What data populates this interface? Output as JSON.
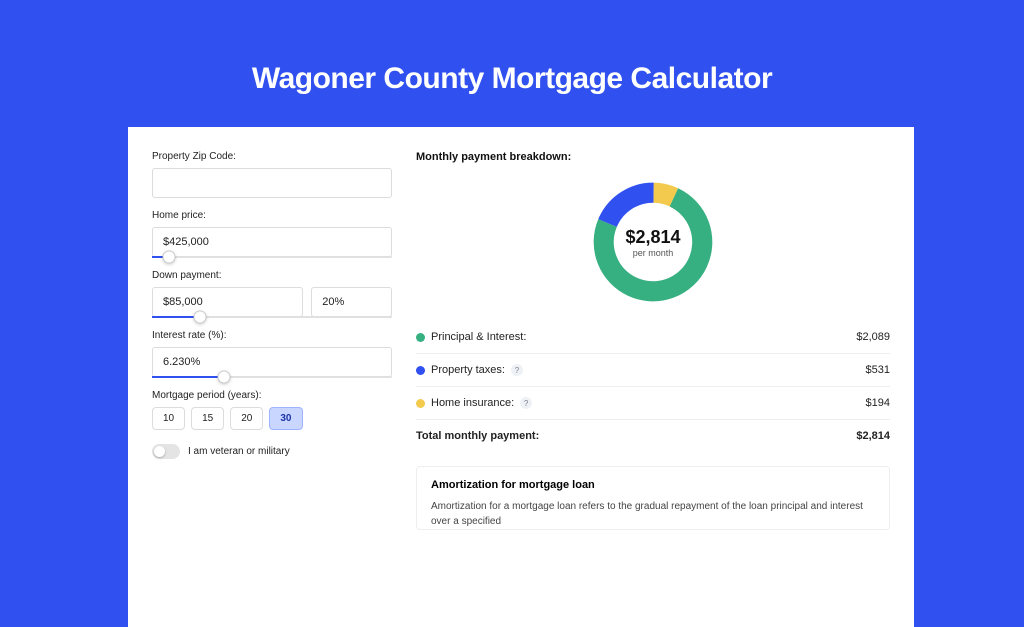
{
  "hero": {
    "title": "Wagoner County Mortgage Calculator"
  },
  "colors": {
    "principal": "#37b081",
    "tax": "#3050ef",
    "insurance": "#f3ca4d"
  },
  "form": {
    "zip": {
      "label": "Property Zip Code:",
      "value": ""
    },
    "home_price": {
      "label": "Home price:",
      "value": "$425,000",
      "pct": 7
    },
    "down": {
      "label": "Down payment:",
      "value": "$85,000",
      "pct_text": "20%",
      "pct": 20
    },
    "rate": {
      "label": "Interest rate (%):",
      "value": "6.230%",
      "pct": 30
    },
    "period": {
      "label": "Mortgage period (years):",
      "options": [
        "10",
        "15",
        "20",
        "30"
      ],
      "selected": "30"
    },
    "vet": {
      "label": "I am veteran or military",
      "on": false
    }
  },
  "breakdown": {
    "title": "Monthly payment breakdown:",
    "center_amount": "$2,814",
    "center_label": "per month",
    "items": [
      {
        "label": "Principal & Interest:",
        "amount": "$2,089",
        "colorKey": "principal",
        "help": false
      },
      {
        "label": "Property taxes:",
        "amount": "$531",
        "colorKey": "tax",
        "help": true
      },
      {
        "label": "Home insurance:",
        "amount": "$194",
        "colorKey": "insurance",
        "help": true
      }
    ],
    "total": {
      "label": "Total monthly payment:",
      "amount": "$2,814"
    }
  },
  "amortization": {
    "title": "Amortization for mortgage loan",
    "text": "Amortization for a mortgage loan refers to the gradual repayment of the loan principal and interest over a specified"
  },
  "chart_data": {
    "type": "pie",
    "title": "Monthly payment breakdown",
    "categories": [
      "Principal & Interest",
      "Property taxes",
      "Home insurance"
    ],
    "values": [
      2089,
      531,
      194
    ],
    "total": 2814
  }
}
